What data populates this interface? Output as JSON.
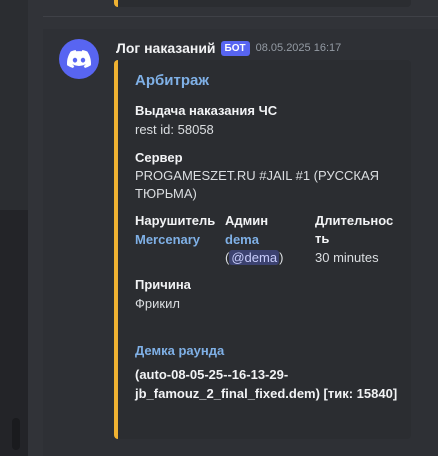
{
  "message": {
    "author": "Лог наказаний",
    "bot_tag": "БОТ",
    "timestamp": "08.05.2025 16:17"
  },
  "embed": {
    "title": "Арбитраж",
    "accent_color": "#f0b232",
    "punishment": {
      "name": "Выдача наказания ЧС",
      "value": "rest id: 58058"
    },
    "server": {
      "name": "Сервер",
      "value_line1": "PROGAMESZET.RU #JAIL #1 (РУССКАЯ",
      "value_line2": "ТЮРЬМА)"
    },
    "offender": {
      "name": "Нарушитель",
      "value": "Mercenary"
    },
    "admin": {
      "name": "Админ",
      "value": "dema",
      "paren_open": "(",
      "mention": "@dema",
      "paren_close": ")"
    },
    "duration": {
      "name_line1": "Длительнос",
      "name_line2": "ть",
      "value": "30 minutes"
    },
    "reason": {
      "name": "Причина",
      "value": "Фрикил"
    },
    "demo": {
      "label": "Демка раунда",
      "line1": "(auto-08-05-25--16-13-29-",
      "line2": "jb_famouz_2_final_fixed.dem) [тик: 15840]"
    }
  },
  "colors": {
    "background": "#313338",
    "embed_background": "#2b2d31",
    "link": "#7fb0e6",
    "bot_tag": "#5865f2"
  }
}
